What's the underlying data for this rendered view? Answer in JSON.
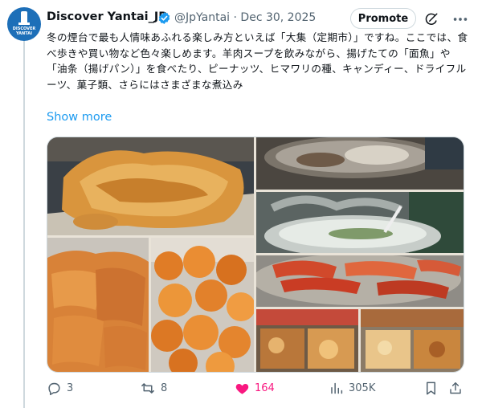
{
  "account": {
    "name": "Discover Yantai_JP",
    "handle": "@JpYantai",
    "date": "Dec 30, 2025",
    "avatar_text": "DISCOVER YANTAI"
  },
  "header": {
    "promote_label": "Promote"
  },
  "tweet": {
    "text": "冬の煙台で最も人情味あふれる楽しみ方といえば「大集（定期市）」ですね。ここでは、食べ歩きや買い物など色々楽しめます。羊肉スープを飲みながら、揚げたての「面魚」や「油条（揚げパン）」を食べたり、ピーナッツ、ヒマワリの種、キャンディー、ドライフルーツ、菓子類、さらにはさまざまな煮込み",
    "show_more": "Show more"
  },
  "actions": {
    "replies": "3",
    "reposts": "8",
    "likes": "164",
    "views": "305K"
  },
  "colors": {
    "accent": "#1d9bf0",
    "like": "#f91880",
    "muted": "#536471",
    "border": "#cfd9de"
  },
  "icons": [
    "verified-badge-icon",
    "grok-icon",
    "more-icon",
    "reply-icon",
    "repost-icon",
    "like-icon",
    "views-icon",
    "bookmark-icon",
    "share-icon"
  ]
}
